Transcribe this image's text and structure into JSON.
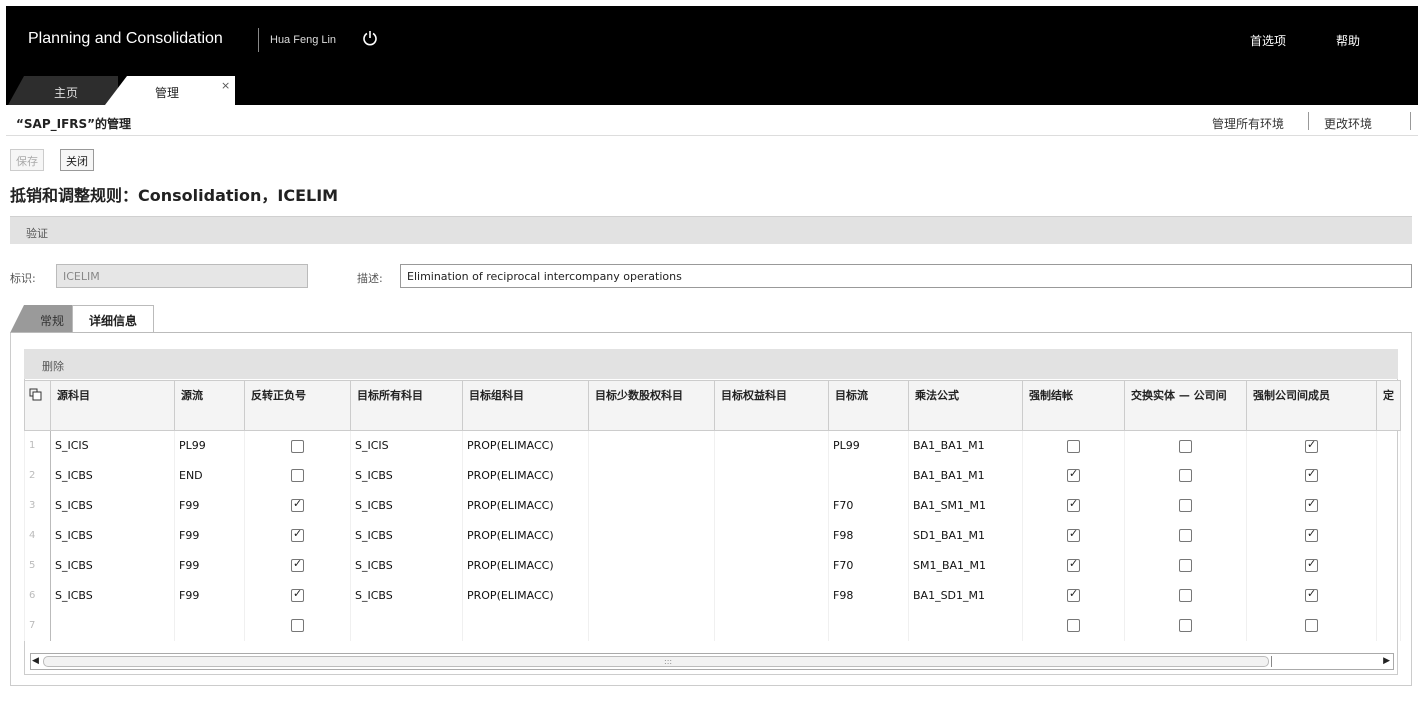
{
  "shell": {
    "app_title": "Planning and Consolidation",
    "user_name": "Hua Feng Lin",
    "links": {
      "preferences": "首选项",
      "help": "帮助"
    },
    "tabs": [
      {
        "label": "主页"
      },
      {
        "label": "管理",
        "close": "×"
      }
    ]
  },
  "admin": {
    "title": "“SAP_IFRS”的管理",
    "manage_all": "管理所有环境",
    "change_env": "更改环境"
  },
  "toolbar": {
    "save_label": "保存",
    "close_label": "关闭"
  },
  "page": {
    "title": "抵销和调整规则：Consolidation，ICELIM",
    "section": "验证",
    "id_label": "标识:",
    "id_value": "ICELIM",
    "desc_label": "描述:",
    "desc_value": "Elimination of reciprocal intercompany operations"
  },
  "subtabs": [
    {
      "label": "常规"
    },
    {
      "label": "详细信息"
    }
  ],
  "grid": {
    "toolbar_label": "删除",
    "columns": [
      "源科目",
      "源流",
      "反转正负号",
      "目标所有科目",
      "目标组科目",
      "目标少数股权科目",
      "目标权益科目",
      "目标流",
      "乘法公式",
      "强制结帐",
      "交换实体 — 公司间",
      "强制公司间成员",
      "定"
    ],
    "rows": [
      {
        "num": "1",
        "src": "S_ICIS",
        "flow": "PL99",
        "rev": false,
        "all": "S_ICIS",
        "grp": "PROP(ELIMACC)",
        "mino": "",
        "eq": "",
        "tflow": "PL99",
        "formula": "BA1_BA1_M1",
        "force": false,
        "swap": false,
        "forceic": true
      },
      {
        "num": "2",
        "src": "S_ICBS",
        "flow": "END",
        "rev": false,
        "all": "S_ICBS",
        "grp": "PROP(ELIMACC)",
        "mino": "",
        "eq": "",
        "tflow": "",
        "formula": "BA1_BA1_M1",
        "force": true,
        "swap": false,
        "forceic": true
      },
      {
        "num": "3",
        "src": "S_ICBS",
        "flow": "F99",
        "rev": true,
        "all": "S_ICBS",
        "grp": "PROP(ELIMACC)",
        "mino": "",
        "eq": "",
        "tflow": "F70",
        "formula": "BA1_SM1_M1",
        "force": true,
        "swap": false,
        "forceic": true
      },
      {
        "num": "4",
        "src": "S_ICBS",
        "flow": "F99",
        "rev": true,
        "all": "S_ICBS",
        "grp": "PROP(ELIMACC)",
        "mino": "",
        "eq": "",
        "tflow": "F98",
        "formula": "SD1_BA1_M1",
        "force": true,
        "swap": false,
        "forceic": true
      },
      {
        "num": "5",
        "src": "S_ICBS",
        "flow": "F99",
        "rev": true,
        "all": "S_ICBS",
        "grp": "PROP(ELIMACC)",
        "mino": "",
        "eq": "",
        "tflow": "F70",
        "formula": "SM1_BA1_M1",
        "force": true,
        "swap": false,
        "forceic": true
      },
      {
        "num": "6",
        "src": "S_ICBS",
        "flow": "F99",
        "rev": true,
        "all": "S_ICBS",
        "grp": "PROP(ELIMACC)",
        "mino": "",
        "eq": "",
        "tflow": "F98",
        "formula": "BA1_SD1_M1",
        "force": true,
        "swap": false,
        "forceic": true
      },
      {
        "num": "7",
        "src": "",
        "flow": "",
        "rev": false,
        "all": "",
        "grp": "",
        "mino": "",
        "eq": "",
        "tflow": "",
        "formula": "",
        "force": false,
        "swap": false,
        "forceic": false
      }
    ]
  },
  "icons": {
    "power": "power-icon",
    "copy": "copy-columns-icon",
    "left": "scroll-left-icon",
    "right": "scroll-right-icon"
  }
}
